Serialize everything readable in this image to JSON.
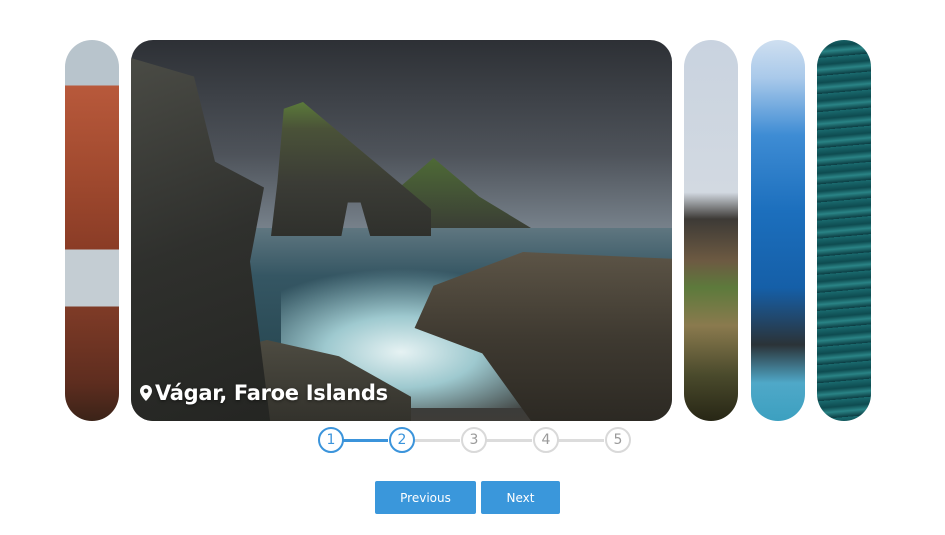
{
  "carousel": {
    "slides": [
      {
        "name": "desert-arch",
        "active": false
      },
      {
        "name": "vagar",
        "active": true,
        "location": "Vágar, Faroe Islands"
      },
      {
        "name": "mountains",
        "active": false
      },
      {
        "name": "blue-ice",
        "active": false
      },
      {
        "name": "water",
        "active": false
      }
    ],
    "location_icon": "map-pin-icon"
  },
  "stepper": {
    "steps": [
      "1",
      "2",
      "3",
      "4",
      "5"
    ],
    "current": 2,
    "active_color": "#3b94db",
    "inactive_color": "#d9d9d9"
  },
  "buttons": {
    "previous_label": "Previous",
    "next_label": "Next",
    "color": "#3a97db"
  }
}
